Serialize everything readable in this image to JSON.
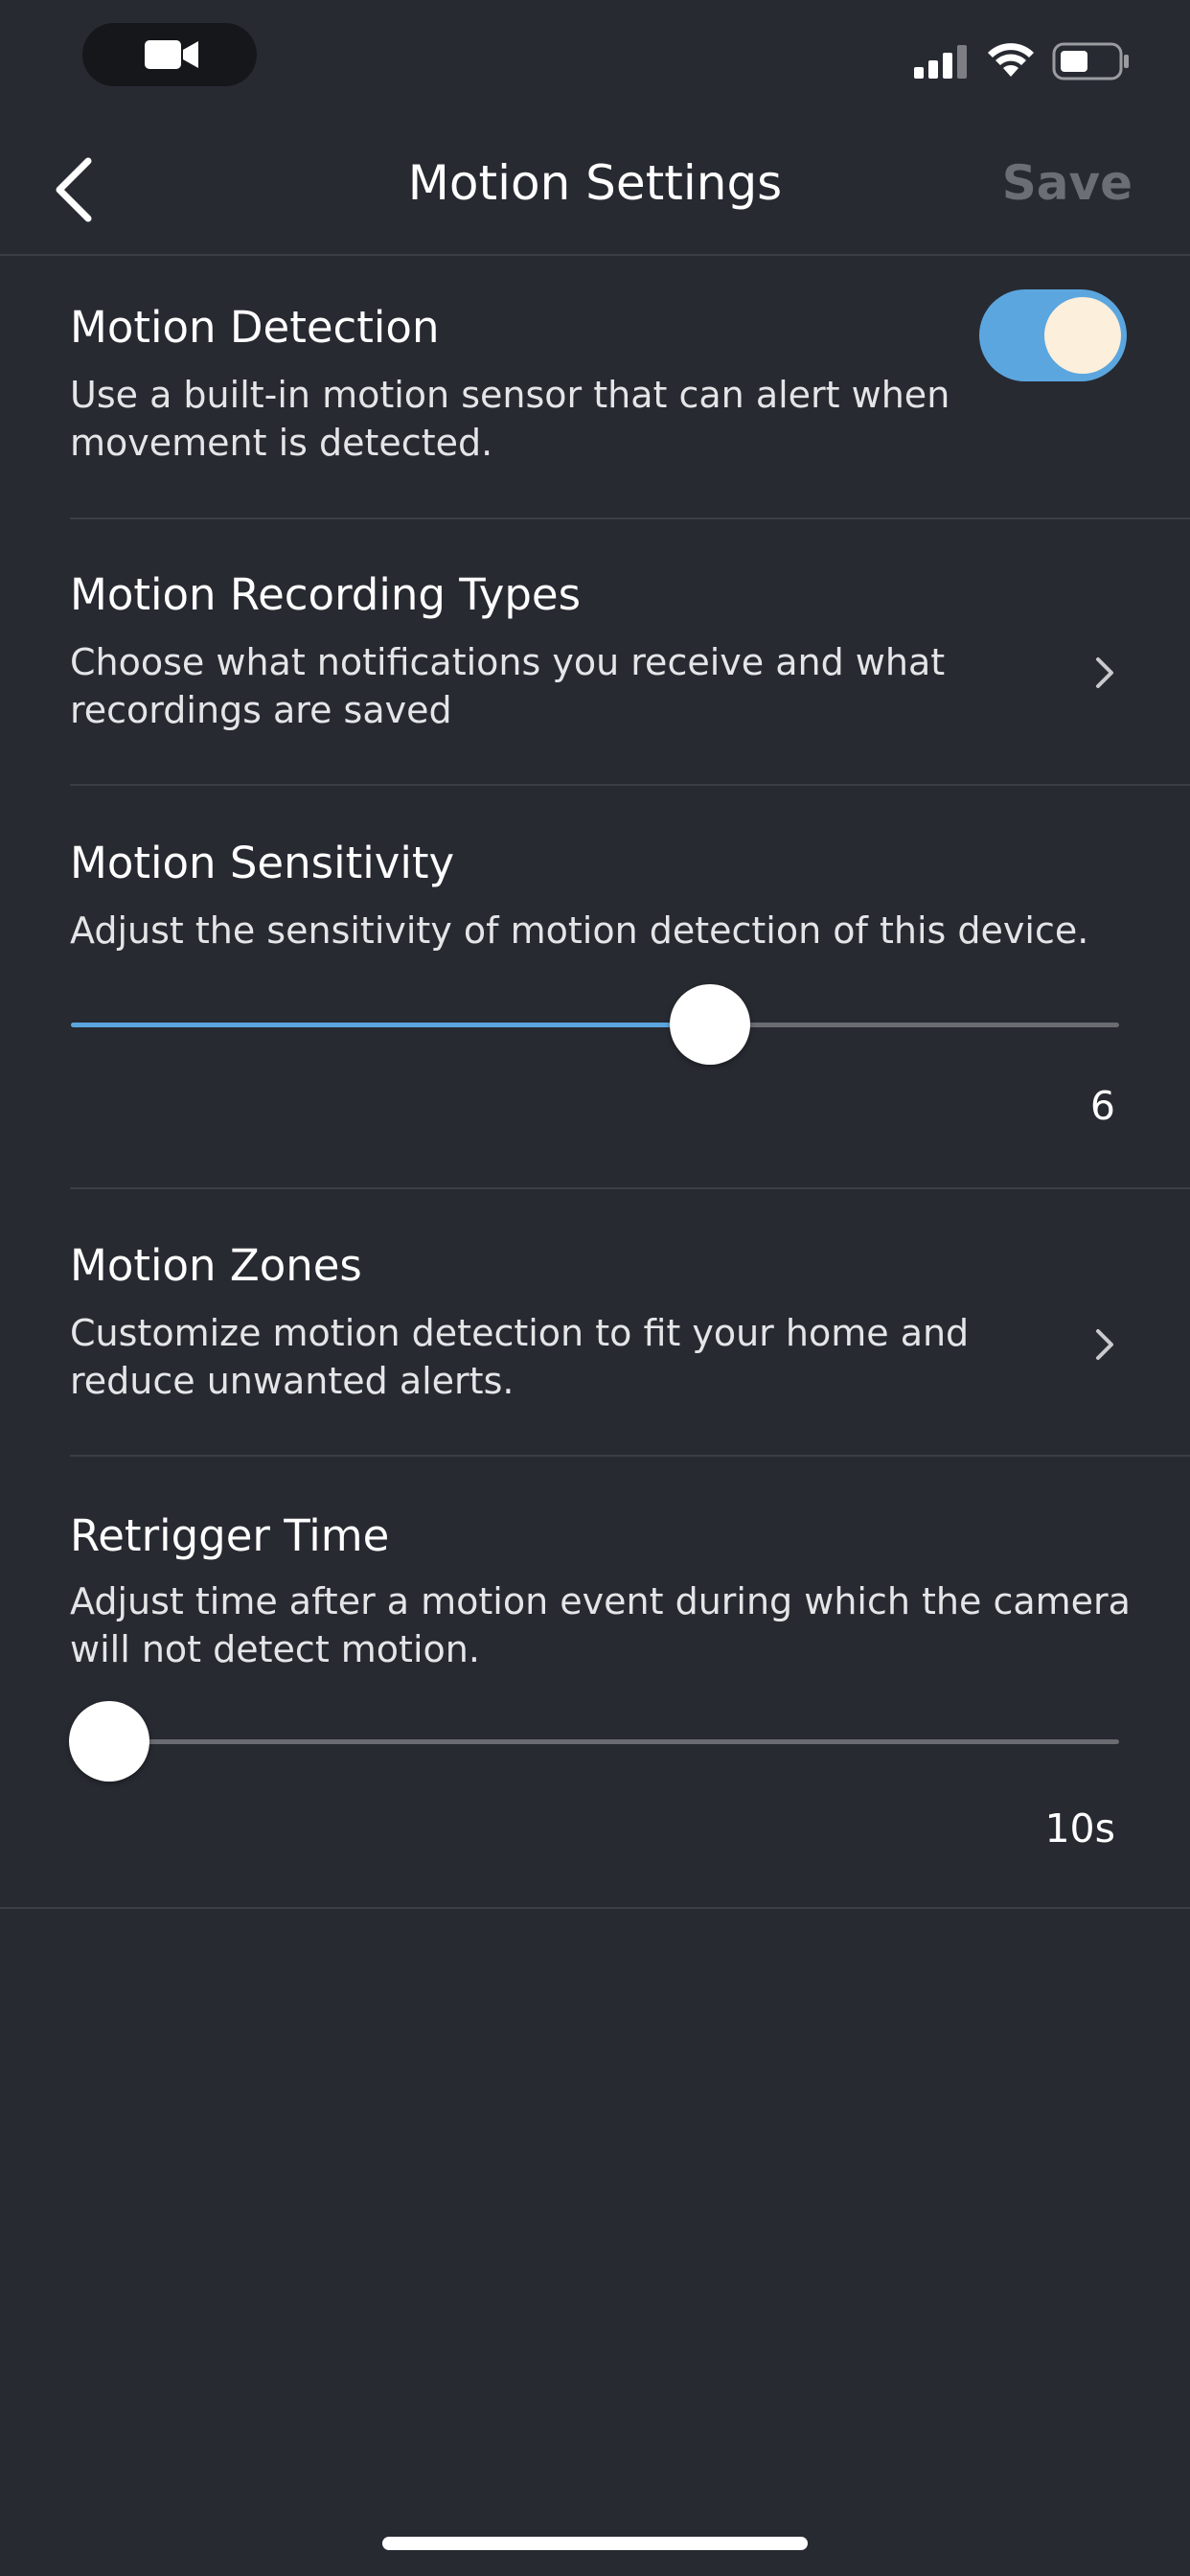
{
  "nav": {
    "title": "Motion Settings",
    "save_label": "Save"
  },
  "motion_detection": {
    "title": "Motion Detection",
    "description_line1": "Use a built-in motion sensor that can alert when",
    "description_line2": "movement is detected.",
    "enabled": true
  },
  "recording_types": {
    "title": "Motion Recording Types",
    "description_line1": "Choose what notifications you receive and what",
    "description_line2": "recordings are saved"
  },
  "sensitivity": {
    "title": "Motion Sensitivity",
    "description_line1": "Adjust the sensitivity of motion detection of this device.",
    "value_label": "6",
    "level_fraction": 0.61
  },
  "zones": {
    "title": "Motion Zones",
    "description_line1": "Customize motion detection to fit your home and",
    "description_line2": "reduce unwanted alerts."
  },
  "retrigger": {
    "title": "Retrigger Time",
    "description_line1": "Adjust time after a motion event during which the camera",
    "description_line2": "will not detect motion.",
    "value_label": "10s",
    "level_fraction": 0.0
  },
  "colors": {
    "background": "#272a31",
    "accent": "#5ba6df",
    "toggle_knob": "#fcefdc",
    "save_disabled": "#6b6e74"
  },
  "icons": [
    "camera-icon",
    "signal-icon",
    "wifi-icon",
    "battery-icon",
    "back-chevron-icon",
    "chevron-right-icon"
  ]
}
